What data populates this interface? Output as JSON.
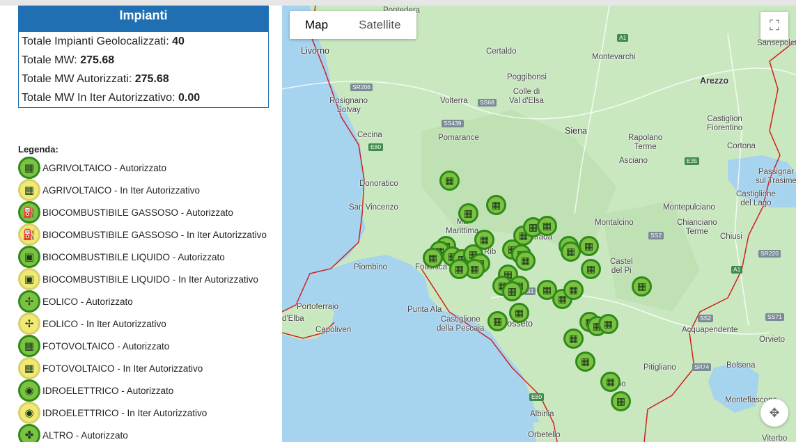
{
  "summary": {
    "title": "Impianti",
    "rows": [
      {
        "label": "Totale Impianti Geolocalizzati:",
        "value": "40"
      },
      {
        "label": "Totale MW:",
        "value": "275.68"
      },
      {
        "label": "Totale MW Autorizzati:",
        "value": "275.68"
      },
      {
        "label": "Totale MW In Iter Autorizzativo:",
        "value": "0.00"
      }
    ]
  },
  "legend": {
    "title": "Legenda:",
    "items": [
      {
        "label": "AGRIVOLTAICO - Autorizzato",
        "status": "auth",
        "icon": "agrivoltaic-icon",
        "glyph": "▦"
      },
      {
        "label": "AGRIVOLTAICO - In Iter Autorizzativo",
        "status": "iter",
        "icon": "agrivoltaic-icon",
        "glyph": "▦"
      },
      {
        "label": "BIOCOMBUSTIBILE GASSOSO - Autorizzato",
        "status": "auth",
        "icon": "gas-tank-icon",
        "glyph": "⛽"
      },
      {
        "label": "BIOCOMBUSTIBILE GASSOSO - In Iter Autorizzativo",
        "status": "iter",
        "icon": "gas-tank-icon",
        "glyph": "⛽"
      },
      {
        "label": "BIOCOMBUSTIBILE LIQUIDO - Autorizzato",
        "status": "auth",
        "icon": "fuel-can-icon",
        "glyph": "▣"
      },
      {
        "label": "BIOCOMBUSTIBILE LIQUIDO - In Iter Autorizzativo",
        "status": "iter",
        "icon": "fuel-can-icon",
        "glyph": "▣"
      },
      {
        "label": "EOLICO - Autorizzato",
        "status": "auth",
        "icon": "wind-turbine-icon",
        "glyph": "✢"
      },
      {
        "label": "EOLICO - In Iter Autorizzativo",
        "status": "iter",
        "icon": "wind-turbine-icon",
        "glyph": "✢"
      },
      {
        "label": "FOTOVOLTAICO - Autorizzato",
        "status": "auth",
        "icon": "solar-panel-icon",
        "glyph": "▦"
      },
      {
        "label": "FOTOVOLTAICO - In Iter Autorizzativo",
        "status": "iter",
        "icon": "solar-panel-icon",
        "glyph": "▦"
      },
      {
        "label": "IDROELETTRICO - Autorizzato",
        "status": "auth",
        "icon": "hydro-plant-icon",
        "glyph": "◉"
      },
      {
        "label": "IDROELETTRICO - In Iter Autorizzativo",
        "status": "iter",
        "icon": "hydro-plant-icon",
        "glyph": "◉"
      },
      {
        "label": "ALTRO - Autorizzato",
        "status": "auth",
        "icon": "other-plant-icon",
        "glyph": "✤"
      }
    ]
  },
  "map": {
    "map_types": {
      "map": "Map",
      "satellite": "Satellite",
      "selected": "Map"
    },
    "fullscreen_icon": "fullscreen-icon",
    "camera_icon": "camera-control-icon",
    "places": [
      "Pontedera",
      "Livorno",
      "Certaldo",
      "Montevarchi",
      "Poggibonsi",
      "Arezzo",
      "Sansepolcro",
      "Colle di Val d'Elsa",
      "Rosignano Solvay",
      "Volterra",
      "Castiglion Fiorentino",
      "Cecina",
      "Siena",
      "Rapolano Terme",
      "Cortona",
      "Pomarance",
      "Asciano",
      "Passignano sul Trasimeno",
      "Donoratico",
      "Castiglione del Lago",
      "San Vincenzo",
      "Montepulciano",
      "Massa Marittima",
      "Montalcino",
      "Chianciano Terme",
      "Chiusi",
      "Ribolla",
      "Roccastrada",
      "Piombino",
      "Follonica",
      "Castel del Piano",
      "Portoferraio",
      "Marina di Campo d'Elba",
      "Capoliveri",
      "Punta Ala",
      "Castiglione della Pescaia",
      "Grosseto",
      "Acquapendente",
      "Orvieto",
      "Pitigliano",
      "Bolsena",
      "Manciano",
      "Montefiascone",
      "Albinia",
      "Orbetello",
      "Viterbo"
    ],
    "roads": [
      "A1",
      "SR206",
      "SS68",
      "SS439",
      "E80",
      "E35",
      "SS2",
      "SR220",
      "A1",
      "SS2",
      "SS71",
      "SR74",
      "E80",
      "S1"
    ],
    "marker_icon": "solar-panel-icon",
    "marker_status": "FOTOVOLTAICO - Autorizzato",
    "marker_color": "#7cc242",
    "marker_border": "#2f8a1a"
  },
  "colors": {
    "header_blue": "#1f6fb2",
    "auth_green": "#7cc242",
    "iter_yellow": "#f0ea74",
    "sea": "#a6d3ee",
    "land": "#c9e8c0",
    "border_red": "#d21f1f"
  }
}
